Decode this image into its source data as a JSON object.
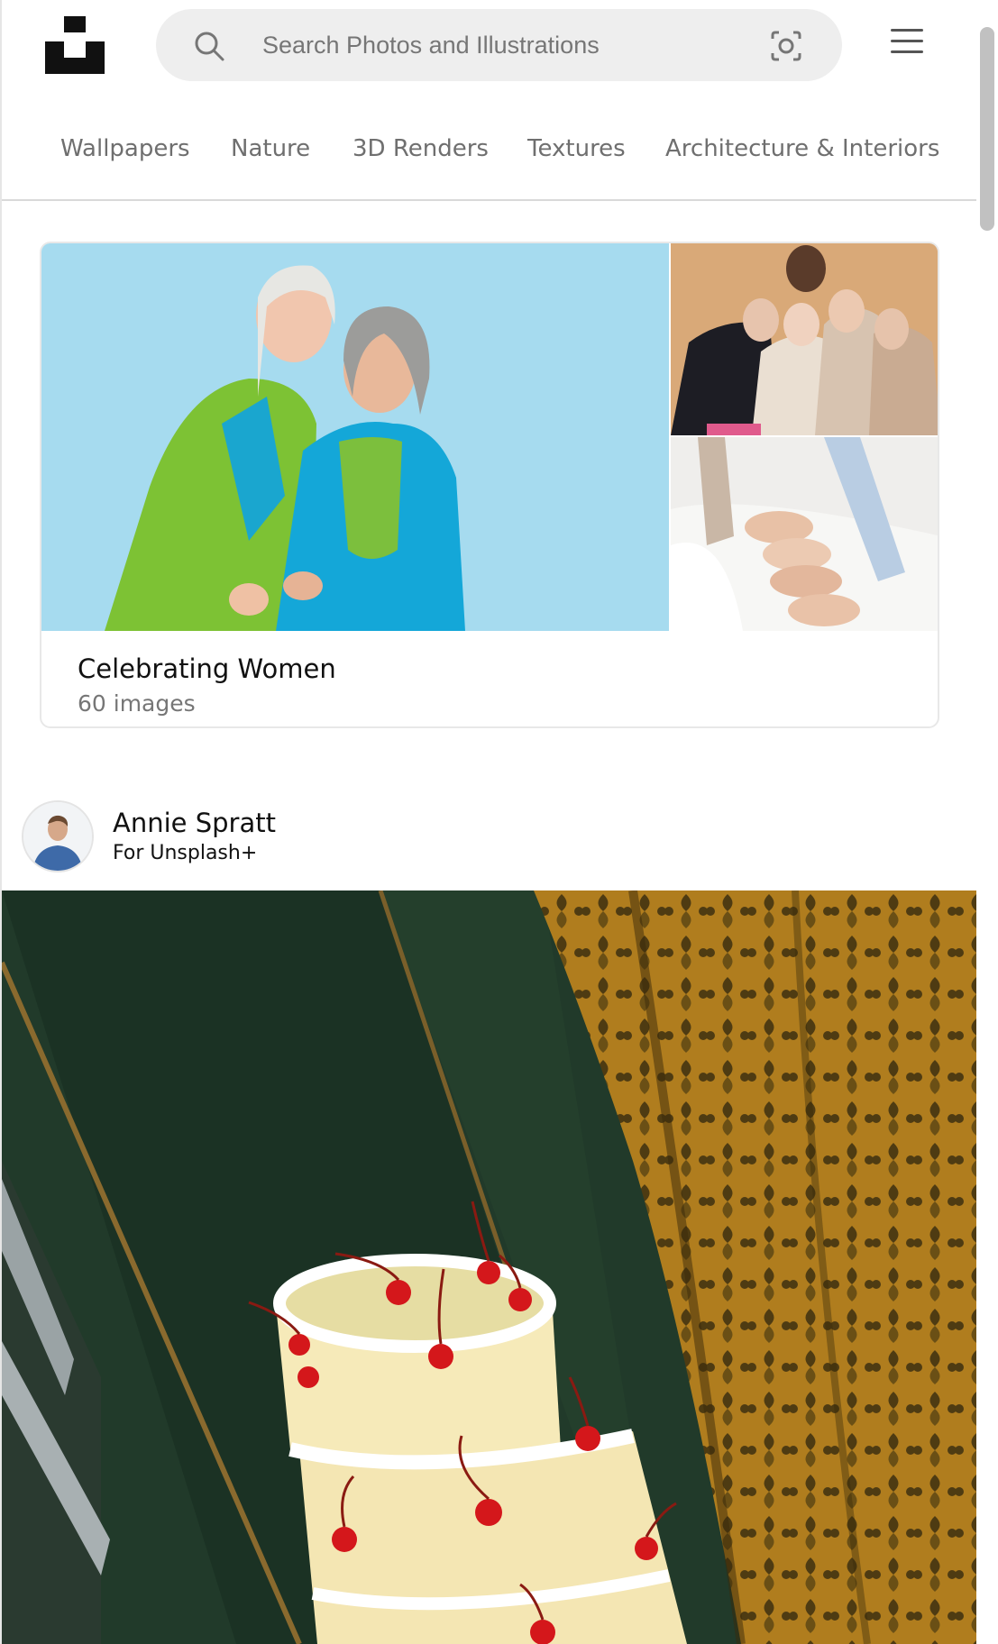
{
  "header": {
    "logo": "unsplash-logo",
    "search": {
      "placeholder": "Search Photos and Illustrations",
      "value": "",
      "search_icon": "search-icon",
      "visual_search_icon": "visual-search-icon"
    },
    "menu_icon": "hamburger-menu-icon"
  },
  "categories": [
    "Wallpapers",
    "Nature",
    "3D Renders",
    "Textures",
    "Architecture & Interiors"
  ],
  "collection": {
    "title": "Celebrating Women",
    "count": "60 images"
  },
  "post": {
    "author_name": "Annie Spratt",
    "author_sub": "For Unsplash+"
  },
  "colors": {
    "text_primary": "#111111",
    "text_secondary": "#767676",
    "search_bg": "#eeeeee"
  }
}
